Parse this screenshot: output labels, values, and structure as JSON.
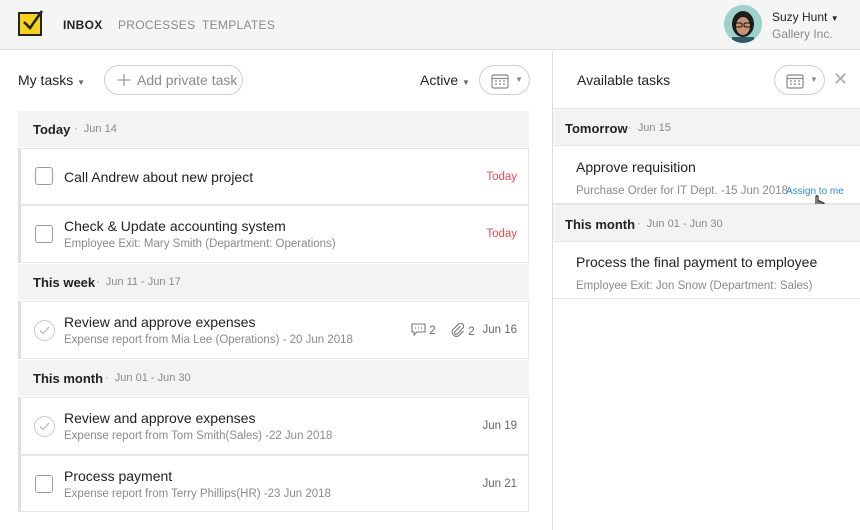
{
  "nav": {
    "tabs": [
      "INBOX",
      "PROCESSES",
      "TEMPLATES"
    ],
    "active_tab": "INBOX",
    "user_name": "Suzy Hunt",
    "user_org": "Gallery Inc."
  },
  "toolbar": {
    "filter_label": "My tasks",
    "add_task_label": "Add private task",
    "status_label": "Active"
  },
  "sections": [
    {
      "title": "Today",
      "range": "Jun 14"
    },
    {
      "title": "This week",
      "range": "Jun 11 - Jun 17"
    },
    {
      "title": "This month",
      "range": "Jun 01 - Jun 30"
    }
  ],
  "tasks": [
    {
      "title": "Call Andrew about new project",
      "subtitle": "",
      "due": "Today"
    },
    {
      "title": "Check & Update accounting system",
      "subtitle": "Employee Exit: Mary Smith (Department: Operations)",
      "due": "Today"
    },
    {
      "title": "Review and approve expenses",
      "subtitle": "Expense report from Mia Lee (Operations) - 20 Jun 2018",
      "due": "Jun 16",
      "comments": "2",
      "attachments": "2"
    },
    {
      "title": "Review and approve expenses",
      "subtitle": "Expense report from Tom Smith(Sales) -22 Jun 2018",
      "due": "Jun 19"
    },
    {
      "title": "Process payment",
      "subtitle": "Expense report from Terry Phillips(HR) -23 Jun 2018",
      "due": "Jun 21"
    }
  ],
  "available": {
    "title": "Available tasks",
    "sections": [
      {
        "title": "Tomorrow",
        "range": "Jun 15"
      },
      {
        "title": "This month",
        "range": "Jun 01 - Jun 30"
      }
    ],
    "tasks": [
      {
        "title": "Approve requisition",
        "subtitle": "Purchase Order for IT Dept. -15 Jun 2018",
        "action": "Assign to me"
      },
      {
        "title": "Process the final payment to employee",
        "subtitle": "Employee Exit: Jon Snow (Department: Sales)"
      }
    ]
  },
  "colors": {
    "brand": "#f7d21c",
    "overdue": "#e05050",
    "link": "#2f8fd0"
  },
  "icons": [
    "checkmark-logo-icon",
    "plus-icon",
    "calendar-icon",
    "chevron-down-icon",
    "close-icon",
    "comment-icon",
    "paperclip-icon",
    "hand-cursor-icon"
  ]
}
